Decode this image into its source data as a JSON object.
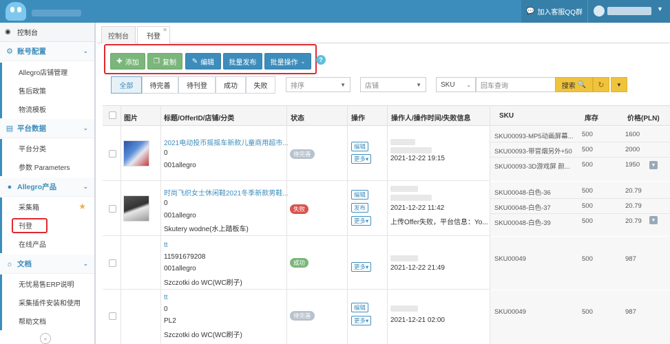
{
  "header": {
    "qq_label": "加入客服QQ群"
  },
  "sidebar": {
    "dashboard": "控制台",
    "groups": [
      {
        "label": "账号配置",
        "items": [
          "Allegro店铺管理",
          "售后政策",
          "物流模板"
        ]
      },
      {
        "label": "平台数据",
        "items": [
          "平台分类",
          "参数 Parameters"
        ]
      },
      {
        "label": "Allegro产品",
        "items": [
          "采集箱",
          "刊登",
          "在线产品"
        ]
      },
      {
        "label": "文档",
        "items": [
          "无忧易售ERP说明",
          "采集插件安装和使用",
          "帮助文档"
        ]
      }
    ]
  },
  "tabs": [
    "控制台",
    "刊登"
  ],
  "toolbar": {
    "add": "添加",
    "copy": "复制",
    "edit": "编辑",
    "batch_publish": "批量发布",
    "batch_ops": "批量操作"
  },
  "filters": {
    "status_tabs": [
      "全部",
      "待完善",
      "待刊登",
      "成功",
      "失败"
    ],
    "sort_placeholder": "排序",
    "store_placeholder": "店铺",
    "field_select": "SKU",
    "search_placeholder": "回车查询",
    "search_label": "搜索"
  },
  "table": {
    "headers": [
      "图片",
      "标题/OfferID/店铺/分类",
      "状态",
      "操作",
      "操作人/操作时间/失败信息",
      "SKU",
      "库存",
      "价格(PLN)"
    ],
    "rows": [
      {
        "title": "2021电动投币摇摇车新款儿童商用超市...",
        "offer_id": "0",
        "store": "001allegro",
        "category": "",
        "status": "待完善",
        "status_color": "#b8c2cc",
        "ops": [
          "编辑",
          "更多"
        ],
        "time": "2021-12-22 19:15",
        "error": "",
        "skus": [
          {
            "sku": "SKU00093-MP5动画屏幕...",
            "stock": "500",
            "price": "1600"
          },
          {
            "sku": "SKU00093-带冒烟另外+50",
            "stock": "500",
            "price": "2000"
          },
          {
            "sku": "SKU00093-3D游戏屏 颜...",
            "stock": "500",
            "price": "1950"
          }
        ]
      },
      {
        "title": "时尚飞织女士休闲鞋2021冬季新款男鞋...",
        "offer_id": "0",
        "store": "001allegro",
        "category": "Skutery wodne(水上踏板车)",
        "status": "失败",
        "status_color": "#d9534f",
        "ops": [
          "编辑",
          "发布",
          "更多"
        ],
        "time": "2021-12-22 11:42",
        "error": "上传Offer失败，平台信息：Yo...",
        "skus": [
          {
            "sku": "SKU00048-白色-36",
            "stock": "500",
            "price": "20.79"
          },
          {
            "sku": "SKU00048-白色-37",
            "stock": "500",
            "price": "20.79"
          },
          {
            "sku": "SKU00048-白色-39",
            "stock": "500",
            "price": "20.79"
          }
        ]
      },
      {
        "title": "tt",
        "offer_id": "11591679208",
        "store": "001allegro",
        "category": "Szczotki do WC(WC刷子)",
        "status": "成功",
        "status_color": "#7bb67a",
        "ops": [
          "更多"
        ],
        "time": "2021-12-22 21:49",
        "error": "",
        "skus": [
          {
            "sku": "SKU00049",
            "stock": "500",
            "price": "987"
          }
        ]
      },
      {
        "title": "tt",
        "offer_id": "0",
        "store": "PL2",
        "category": "Szczotki do WC(WC刷子)",
        "status": "待完善",
        "status_color": "#b8c2cc",
        "ops": [
          "编辑",
          "更多"
        ],
        "time": "2021-12-21 02:00",
        "error": "",
        "skus": [
          {
            "sku": "SKU00049",
            "stock": "500",
            "price": "987"
          }
        ]
      }
    ]
  },
  "colors": {
    "brand": "#3c8dbc",
    "green": "#7bb67a",
    "warn": "#f0c33c",
    "highlight": "#e0282f"
  }
}
